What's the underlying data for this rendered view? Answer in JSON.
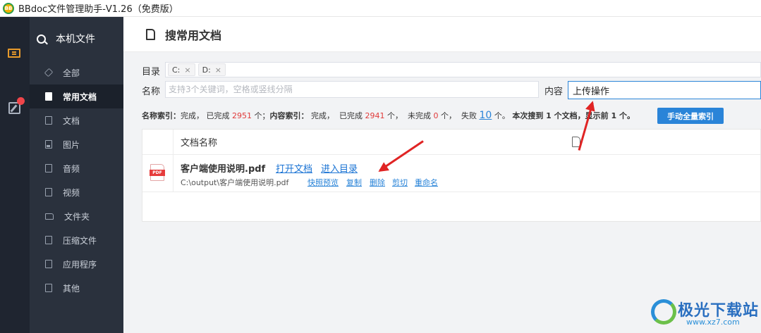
{
  "window": {
    "title": "BBdoc文件管理助手-V1.26（免费版）",
    "logo_text": "BB"
  },
  "sidebar": {
    "header": "本机文件",
    "items": [
      {
        "label": "全部",
        "icon": "layers-icon"
      },
      {
        "label": "常用文档",
        "icon": "document-icon",
        "active": true
      },
      {
        "label": "文档",
        "icon": "file-text-icon"
      },
      {
        "label": "图片",
        "icon": "image-icon"
      },
      {
        "label": "音频",
        "icon": "audio-icon"
      },
      {
        "label": "视频",
        "icon": "video-icon"
      },
      {
        "label": "文件夹",
        "icon": "folder-icon"
      },
      {
        "label": "压缩文件",
        "icon": "archive-icon"
      },
      {
        "label": "应用程序",
        "icon": "app-icon"
      },
      {
        "label": "其他",
        "icon": "other-icon"
      }
    ]
  },
  "header": {
    "title": "搜常用文档"
  },
  "filters": {
    "dir_label": "目录",
    "drives": [
      "C:",
      "D:"
    ],
    "close_glyph": "×",
    "name_label": "名称",
    "name_placeholder": "支持3个关键词，空格或竖线分隔",
    "content_label": "内容",
    "content_value": "上传操作"
  },
  "status": {
    "name_index_label": "名称索引：",
    "done": "完成，",
    "completed_prefix": "已完成",
    "name_completed": "2951",
    "unit": "个；",
    "content_index_label": "内容索引：",
    "content_completed": "2941",
    "unit2": "个，",
    "incomplete_prefix": "未完成",
    "incomplete": "0",
    "failed_prefix": "失败",
    "failed": "10",
    "unit3": "个。",
    "found_text": "本次搜到 1 个文档，显示前 1 个。",
    "full_index_button": "手动全量索引"
  },
  "table": {
    "column": "文档名称",
    "rows": [
      {
        "name": "客户端使用说明.pdf",
        "open": "打开文档",
        "enter_dir": "进入目录",
        "path": "C:\\output\\客户端使用说明.pdf",
        "actions": [
          "快照预览",
          "复制",
          "删除",
          "剪切",
          "重命名"
        ],
        "type_badge": "PDF"
      }
    ]
  },
  "watermark": {
    "text": "极光下载站",
    "url": "www.xz7.com"
  },
  "colors": {
    "accent": "#2a84d8",
    "sidebar_bg": "#2a313d",
    "rail_bg": "#1f2530",
    "alert_red": "#e03a3a"
  }
}
